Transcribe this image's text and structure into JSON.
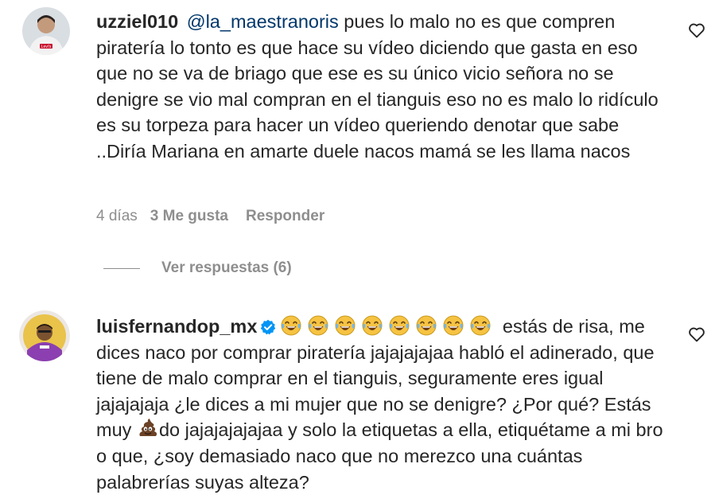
{
  "comments": [
    {
      "username": "uzziel010",
      "mention": "@la_maestranoris",
      "text": " pues lo malo no es que compren piratería lo tonto es que hace su vídeo diciendo que gasta en eso que no se va de briago que ese es su único vicio señora no se denigre se vio mal compran en el tianguis eso no es malo lo ridículo es su torpeza para hacer un vídeo queriendo denotar que sabe ..Diría Mariana en amarte duele nacos mamá se les llama nacos",
      "time": "4 días",
      "likes": "3 Me gusta",
      "reply_label": "Responder",
      "view_replies": "Ver respuestas (6)",
      "avatar_text": "Levi's",
      "icons": {
        "like": "heart-outline-icon"
      }
    },
    {
      "username": "luisfernandop_mx",
      "verified": true,
      "text_part1": " estás de risa, me dices naco por comprar piratería jajajajajaa habló el adinerado, que tiene de malo comprar en el tianguis, seguramente eres igual jajajajaja ¿le dices a mi mujer que no se denigre? ¿Por qué? Estás muy ",
      "text_part2": "do jajajajajajaa y solo la etiquetas a ella, etiquétame a mi bro o que, ¿soy demasiado naco que no merezco una cuántas palabrerías suyas alteza?",
      "emoji_laugh": "😂",
      "emoji_laugh_count": 8,
      "emoji_poop": "💩",
      "icons": {
        "like": "heart-outline-icon",
        "verified": "verified-badge-icon"
      }
    }
  ],
  "colors": {
    "text": "#262626",
    "secondary": "#8e8e8e",
    "mention": "#00376b",
    "verified": "#0095f6"
  }
}
